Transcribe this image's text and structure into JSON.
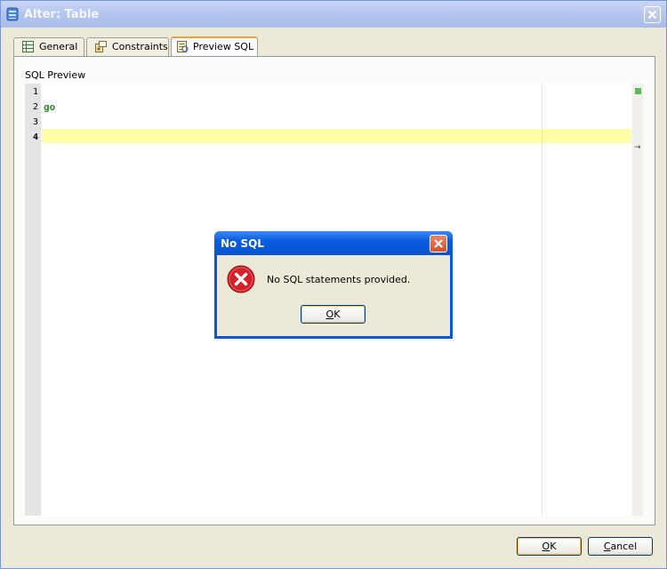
{
  "window": {
    "title": "Alter: Table",
    "icon": "table-icon"
  },
  "tabs": [
    {
      "label": "General",
      "icon": "table-grid-icon",
      "selected": false
    },
    {
      "label": "Constraints",
      "icon": "constraints-icon",
      "selected": false
    },
    {
      "label": "Preview SQL",
      "icon": "sql-preview-icon",
      "selected": true
    }
  ],
  "preview": {
    "label": "SQL Preview",
    "line_numbers": [
      "1",
      "2",
      "3",
      "4"
    ],
    "code_line2": "go",
    "current_line": "4"
  },
  "footer": {
    "ok_label": "OK",
    "ok_mnemonic": "O",
    "ok_rest": "K",
    "cancel_label": "Cancel",
    "cancel_mnemonic": "C",
    "cancel_rest": "ancel"
  },
  "dialog": {
    "title": "No SQL",
    "message": "No SQL statements provided.",
    "ok_mnemonic": "O",
    "ok_rest": "K",
    "icon": "error-icon"
  },
  "colors": {
    "titlebar_accent": "#0a58d6",
    "current_line_highlight": "#ffffa8",
    "code_keyword": "#2a8a2a"
  }
}
